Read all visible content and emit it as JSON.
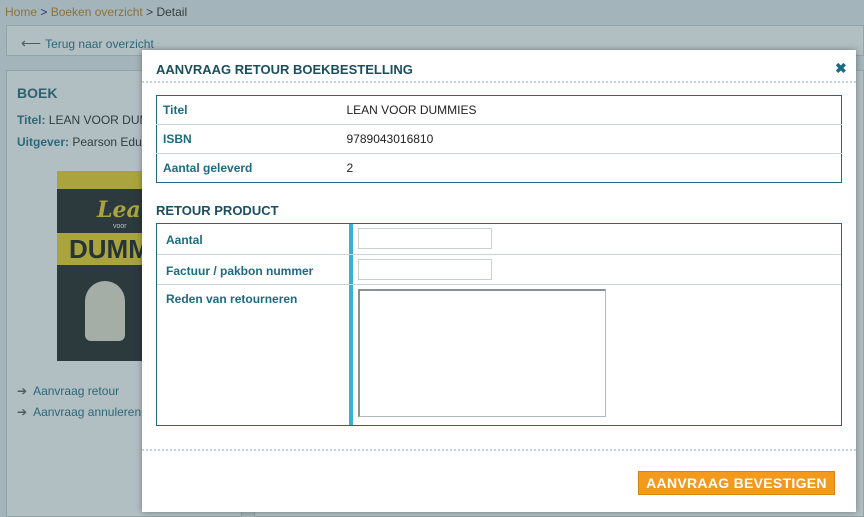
{
  "breadcrumb": {
    "home": "Home",
    "sep1": " > ",
    "overview": "Boeken overzicht",
    "sep2": " > ",
    "current": "Detail"
  },
  "back_link": "Terug naar overzicht",
  "book": {
    "heading": "BOEK",
    "title_label": "Titel:",
    "title_value": "LEAN VOOR DUMMIES",
    "publisher_label": "Uitgever:",
    "publisher_value": "Pearson Education",
    "cover": {
      "word1": "Lean",
      "word2": "voor",
      "word3": "DUMMIES"
    }
  },
  "side_links": [
    "Aanvraag retour",
    "Aanvraag annuleren"
  ],
  "modal": {
    "title": "AANVRAAG RETOUR BOEKBESTELLING",
    "close_symbol": "✖",
    "info": {
      "rows": [
        {
          "label": "Titel",
          "value": "LEAN VOOR DUMMIES"
        },
        {
          "label": "ISBN",
          "value": "9789043016810"
        },
        {
          "label": "Aantal geleverd",
          "value": "2"
        }
      ]
    },
    "section_title": "RETOUR PRODUCT",
    "form": {
      "quantity_label": "Aantal",
      "quantity_value": "",
      "invoice_label": "Factuur / pakbon nummer",
      "invoice_value": "",
      "reason_label": "Reden van retourneren",
      "reason_value": ""
    },
    "confirm_label": "AANVRAAG BEVESTIGEN"
  },
  "colors": {
    "accent_orange": "#f39a1c",
    "link_teal": "#1b6c82",
    "bar_blue": "#35b3d4"
  }
}
